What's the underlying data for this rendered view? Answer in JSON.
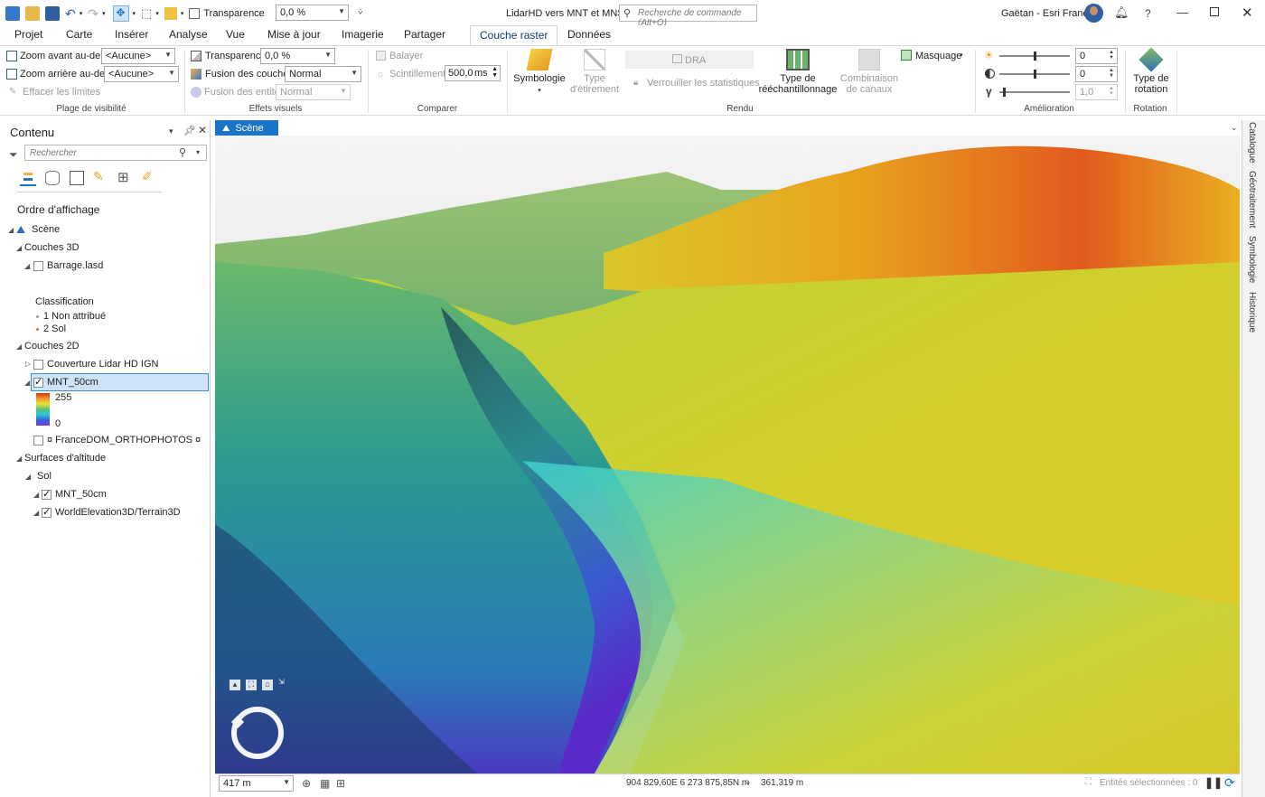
{
  "title_bar": {
    "transparency_label": "Transparence",
    "transparency_value": "0,0 %",
    "doc_title": "LidarHD vers MNT et MNS",
    "search_placeholder": "Recherche de commande (Alt+Q)",
    "user": "Gaëtan - Esri France",
    "help": "?"
  },
  "tabs": [
    "Projet",
    "Carte",
    "Insérer",
    "Analyse",
    "Vue",
    "Mise à jour",
    "Imagerie",
    "Partager",
    "Couche raster",
    "Données"
  ],
  "ribbon": {
    "visibility": {
      "zoom_in_label": "Zoom avant au-delà",
      "zoom_in_value": "<Aucune>",
      "zoom_out_label": "Zoom arrière au-delà",
      "zoom_out_value": "<Aucune>",
      "clear_limits": "Effacer les limites",
      "group": "Plage de visibilité"
    },
    "effects": {
      "transparency_label": "Transparence",
      "transparency_value": "0,0 %",
      "blend_label": "Fusion des couches",
      "blend_value": "Normal",
      "feature_blend_label": "Fusion des entités",
      "feature_blend_value": "Normal",
      "group": "Effets visuels"
    },
    "compare": {
      "swipe": "Balayer",
      "flicker": "Scintillement",
      "flicker_value": "500,0",
      "flicker_unit": "ms",
      "group": "Comparer"
    },
    "rendering": {
      "symbology": "Symbologie",
      "stretch_line1": "Type",
      "stretch_line2": "d'étirement",
      "dra": "DRA",
      "lock_stats": "Verrouiller les statistiques",
      "resample_line1": "Type de",
      "resample_line2": "rééchantillonnage",
      "bands_line1": "Combinaison",
      "bands_line2": "de canaux",
      "mask": "Masquage",
      "group": "Rendu"
    },
    "enhancement": {
      "brightness": "0",
      "contrast": "0",
      "gamma": "1,0",
      "group": "Amélioration"
    },
    "rotation": {
      "line1": "Type de",
      "line2": "rotation",
      "group": "Rotation"
    }
  },
  "contents": {
    "title": "Contenu",
    "search_placeholder": "Rechercher",
    "draw_order": "Ordre d'affichage",
    "scene": "Scène",
    "layers3d": "Couches 3D",
    "barrage": "Barrage.lasd",
    "classification": "Classification",
    "class1": "1  Non attribué",
    "class2": "2  Sol",
    "layers2d": "Couches 2D",
    "coverage": "Couverture Lidar HD IGN",
    "mnt": "MNT_50cm",
    "legend_high": "255",
    "legend_low": "0",
    "francedom": "¤ FranceDOM_ORTHOPHOTOS ¤",
    "elevation": "Surfaces d'altitude",
    "ground": "Sol",
    "surf1": "MNT_50cm",
    "surf2": "WorldElevation3D/Terrain3D"
  },
  "map": {
    "tab": "Scène",
    "scale": "417 m",
    "coordinates": "904 829,60E 6 273 875,85N m",
    "elevation": "361,319 m",
    "selected": "Entités sélectionnées : 0"
  },
  "dock": [
    "Catalogue",
    "Géotraitement",
    "Symbologie",
    "Historique"
  ]
}
